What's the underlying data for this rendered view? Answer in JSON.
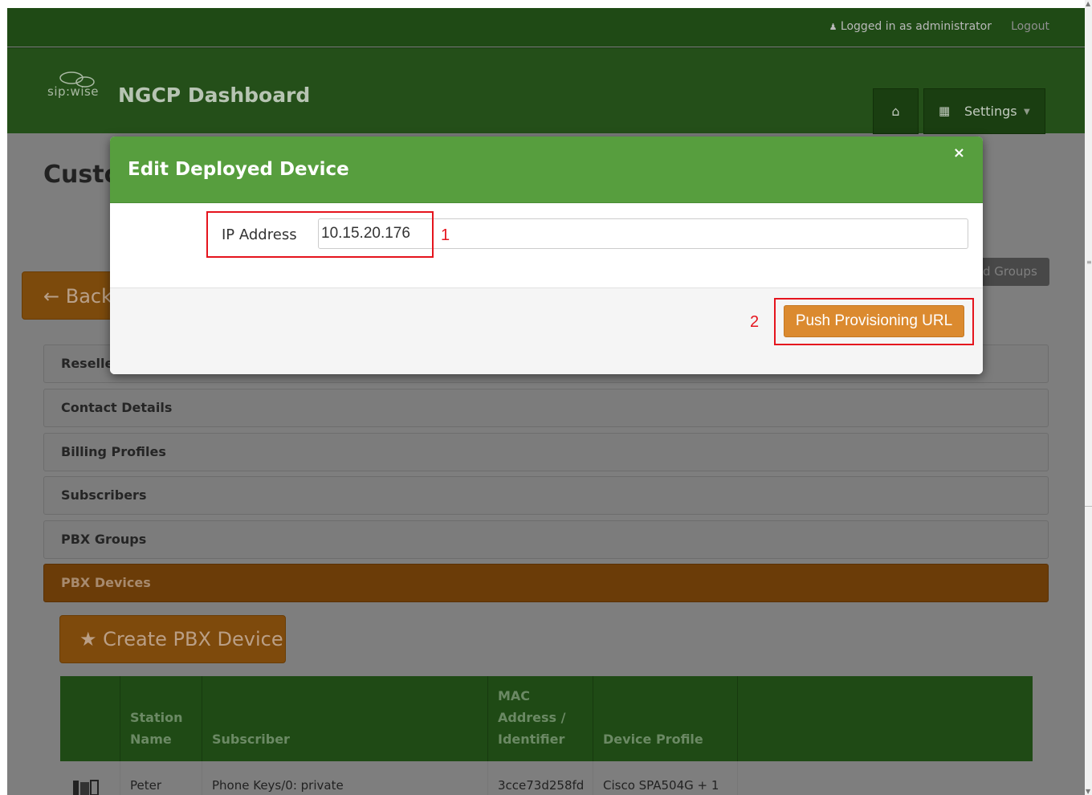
{
  "topbar": {
    "user_text": "Logged in as administrator",
    "logout": "Logout"
  },
  "header": {
    "logo_text": "sip:wise",
    "title": "NGCP Dashboard",
    "settings_label": "Settings"
  },
  "page": {
    "title": "Custo",
    "back_label": "Back",
    "groups_label": "d Groups"
  },
  "accordion": [
    {
      "label": "Reseller"
    },
    {
      "label": "Contact Details"
    },
    {
      "label": "Billing Profiles"
    },
    {
      "label": "Subscribers"
    },
    {
      "label": "PBX Groups"
    },
    {
      "label": "PBX Devices"
    }
  ],
  "create_button": "Create PBX Device",
  "table": {
    "headers": [
      "",
      "Station Name",
      "Subscriber",
      "MAC Address / Identifier",
      "Device Profile",
      ""
    ],
    "rows": [
      {
        "station": "Peter",
        "subscriber": "Phone Keys/0: private",
        "mac": "3cce73d258fd",
        "profile": "Cisco SPA504G + 1"
      }
    ]
  },
  "modal": {
    "title": "Edit Deployed Device",
    "close": "×",
    "field_label": "IP Address",
    "ip_value": "10.15.20.176",
    "push_button": "Push Provisioning URL"
  },
  "annotations": [
    "1",
    "2"
  ],
  "colors": {
    "modal_header": "#579e3e",
    "push_button": "#db8a2f",
    "annotation": "#e5141d"
  }
}
